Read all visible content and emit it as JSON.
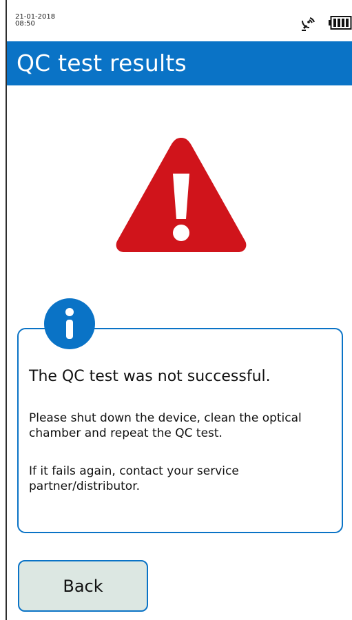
{
  "status_bar": {
    "date": "21-01-2018",
    "time": "08:50",
    "signal_icon": "satellite-signal-icon",
    "battery_icon": "battery-full-icon"
  },
  "header": {
    "title": "QC test results",
    "background_color": "#0a73c6"
  },
  "warning": {
    "icon": "warning-triangle-icon",
    "color": "#d0141b"
  },
  "info_card": {
    "icon": "info-icon",
    "heading": "The QC test was not successful.",
    "paragraph_1": "Please shut down the device, clean the optical chamber and repeat the QC test.",
    "paragraph_2": "If it fails again, contact your service partner/distributor.",
    "border_color": "#0a73c6"
  },
  "actions": {
    "back_label": "Back"
  }
}
